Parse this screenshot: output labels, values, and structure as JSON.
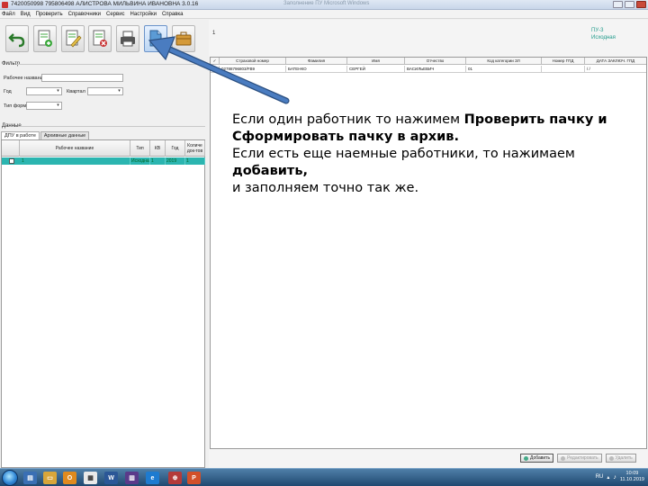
{
  "window": {
    "title": "7420050998 795806498 АЛИСТРОВА МИЛЬВИНА ИВАНОВНА 3.0.16",
    "title_right": "Заполнение ПУ  Microsoft Windows"
  },
  "menu": [
    "Файл",
    "Вид",
    "Проверить",
    "Справочники",
    "Сервис",
    "Настройки",
    "Справка"
  ],
  "filter": {
    "section_label": "Фильтр",
    "name_label": "Рабочее название",
    "year_label": "Год",
    "quarter_label": "Квартал",
    "form_type_label": "Тип формы"
  },
  "data_section": {
    "label": "Данные",
    "tabs": [
      "ДПУ в работе",
      "Архивные данные"
    ],
    "columns": [
      "Рабочее название",
      "Тип",
      "КВ",
      "Год",
      "Количе док-тов"
    ],
    "row": {
      "num": "1",
      "type": "Исходная",
      "kv": "1",
      "year": "2019",
      "count": "1"
    }
  },
  "document": {
    "page_number": "1",
    "form_code": "ПУ-3",
    "form_sub": "Исходная",
    "columns": [
      "Страховой номер",
      "Фамилия",
      "Имя",
      "Отчество",
      "Код категории ЗЛ",
      "Номер ГПД",
      "ДАТА ЗАКЛЮЧ. ГПД"
    ],
    "row": {
      "num": "1",
      "snils": "02788796803/FB9",
      "surname": "БАТЕНКО",
      "name": "СЕРГЕЙ",
      "patronymic": "ВАСИЛЬЕВИЧ",
      "category": "01",
      "gpd_number": "",
      "gpd_date": "/ /"
    }
  },
  "bottom_buttons": [
    "Добавить",
    "Редактировать",
    "Удалить"
  ],
  "instruction": {
    "line1_plain": "Если один работник то нажимем ",
    "line1_bold": "Проверить пачку и Сформировать пачку в архив.",
    "line2_plain": "Если есть еще наемные работники, то нажимаем ",
    "line2_bold": "добавить,",
    "line3_plain": "и заполняем точно так же."
  },
  "tray": {
    "lang": "RU",
    "time": "10:09",
    "date": "11.10.2019"
  },
  "colors": {
    "row_highlight": "#2bb5b0",
    "arrow": "#3f6fb0",
    "form_code": "#1f9a8a"
  }
}
